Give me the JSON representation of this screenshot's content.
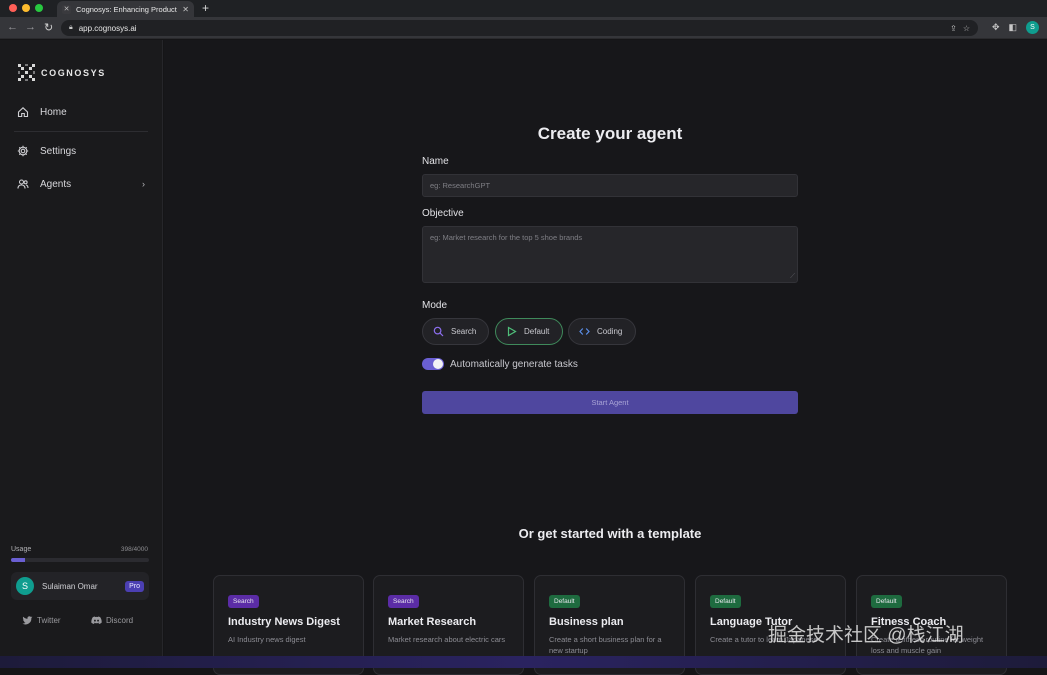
{
  "browser": {
    "tab_title": "Cognosys: Enhancing Productiv",
    "url": "app.cognosys.ai",
    "profile_initial": "S"
  },
  "sidebar": {
    "brand": "COGNOSYS",
    "items": [
      {
        "label": "Home",
        "icon": "home-icon"
      },
      {
        "label": "Settings",
        "icon": "gear-icon"
      },
      {
        "label": "Agents",
        "icon": "users-icon"
      }
    ],
    "usage": {
      "label": "Usage",
      "count": "398/4000",
      "fraction": 0.1
    },
    "user": {
      "initial": "S",
      "name": "Sulaiman Omar",
      "plan": "Pro"
    },
    "links": {
      "twitter": "Twitter",
      "discord": "Discord"
    }
  },
  "form": {
    "title": "Create your agent",
    "name_label": "Name",
    "name_placeholder": "eg: ResearchGPT",
    "objective_label": "Objective",
    "objective_placeholder": "eg: Market research for the top 5 shoe brands",
    "mode_label": "Mode",
    "modes": [
      {
        "label": "Search",
        "icon": "search-icon"
      },
      {
        "label": "Default",
        "icon": "play-icon",
        "selected": true
      },
      {
        "label": "Coding",
        "icon": "code-icon"
      }
    ],
    "auto_tasks_label": "Automatically generate tasks",
    "auto_tasks_on": true,
    "start_button": "Start Agent"
  },
  "templates": {
    "heading": "Or get started with a template",
    "cards": [
      {
        "badge": "Search",
        "title": "Industry News Digest",
        "desc": "AI Industry news digest"
      },
      {
        "badge": "Search",
        "title": "Market Research",
        "desc": "Market research about electric cars"
      },
      {
        "badge": "Default",
        "title": "Business plan",
        "desc": "Create a short business plan for a new startup"
      },
      {
        "badge": "Default",
        "title": "Language Tutor",
        "desc": "Create a tutor to learn Japanese"
      },
      {
        "badge": "Default",
        "title": "Fitness Coach",
        "desc": "Create a fitness routine for weight loss and muscle gain"
      }
    ]
  },
  "overlay": {
    "watermark": "掘金技术社区 @栈江湖"
  },
  "colors": {
    "accent": "#6a5fd2",
    "default_green": "#3f8a5b",
    "search_purple": "#5b2ca6"
  }
}
